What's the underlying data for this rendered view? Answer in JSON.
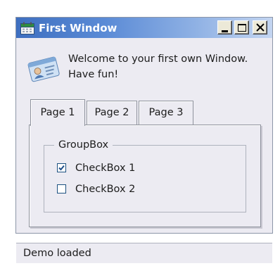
{
  "window": {
    "title": "First Window",
    "app_icon": "calendar-icon",
    "controls": {
      "minimize_icon": "minimize-icon",
      "maximize_icon": "maximize-icon",
      "close_icon": "close-icon"
    }
  },
  "welcome": {
    "icon": "id-card-icon",
    "text": "Welcome to your first own Window. Have fun!"
  },
  "tabs": [
    {
      "label": "Page 1",
      "active": true
    },
    {
      "label": "Page 2",
      "active": false
    },
    {
      "label": "Page 3",
      "active": false
    }
  ],
  "groupbox": {
    "title": "GroupBox",
    "checkboxes": [
      {
        "label": "CheckBox 1",
        "checked": true
      },
      {
        "label": "CheckBox 2",
        "checked": false
      }
    ]
  },
  "status": {
    "text": "Demo loaded"
  },
  "colors": {
    "titlebar_start": "#3e6fc0",
    "titlebar_end": "#c3d5f1",
    "window_bg": "#ecebf2",
    "checkmark": "#1f4f8a"
  }
}
